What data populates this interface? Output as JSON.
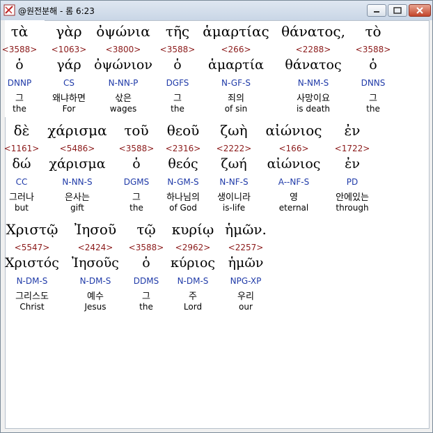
{
  "window": {
    "title": "@원전분해 - 롬 6:23"
  },
  "rows": [
    {
      "words": [
        {
          "greek": "τὰ",
          "strong": "<3588>",
          "lemma": "ὁ",
          "parse": "DNNP",
          "kor": "그",
          "eng": "the"
        },
        {
          "greek": "γὰρ",
          "strong": "<1063>",
          "lemma": "γάρ",
          "parse": "CS",
          "kor": "왜냐하면",
          "eng": "For"
        },
        {
          "greek": "ὀψώνια",
          "strong": "<3800>",
          "lemma": "ὀψώνιον",
          "parse": "N-NN-P",
          "kor": "삯은",
          "eng": "wages"
        },
        {
          "greek": "τῆς",
          "strong": "<3588>",
          "lemma": "ὁ",
          "parse": "DGFS",
          "kor": "그",
          "eng": "the"
        },
        {
          "greek": "ἁμαρτίας",
          "strong": "<266>",
          "lemma": "ἁμαρτία",
          "parse": "N-GF-S",
          "kor": "죄의",
          "eng": "of sin"
        },
        {
          "greek": "θάνατος,",
          "strong": "<2288>",
          "lemma": "θάνατος",
          "parse": "N-NM-S",
          "kor": "사망이요",
          "eng": "is death"
        },
        {
          "greek": "τὸ",
          "strong": "<3588>",
          "lemma": "ὁ",
          "parse": "DNNS",
          "kor": "그",
          "eng": "the"
        }
      ]
    },
    {
      "words": [
        {
          "greek": "δὲ",
          "strong": "<1161>",
          "lemma": "δώ",
          "parse": "CC",
          "kor": "그러나",
          "eng": "but"
        },
        {
          "greek": "χάρισμα",
          "strong": "<5486>",
          "lemma": "χάρισμα",
          "parse": "N-NN-S",
          "kor": "은사는",
          "eng": "gift"
        },
        {
          "greek": "τοῦ",
          "strong": "<3588>",
          "lemma": "ὁ",
          "parse": "DGMS",
          "kor": "그",
          "eng": "the"
        },
        {
          "greek": "θεοῦ",
          "strong": "<2316>",
          "lemma": "θεός",
          "parse": "N-GM-S",
          "kor": "하나님의",
          "eng": "of God"
        },
        {
          "greek": "ζωὴ",
          "strong": "<2222>",
          "lemma": "ζωή",
          "parse": "N-NF-S",
          "kor": "생이니라",
          "eng": "is-life"
        },
        {
          "greek": "αἰώνιος",
          "strong": "<166>",
          "lemma": "αἰώνιος",
          "parse": "A--NF-S",
          "kor": "영",
          "eng": "eternal"
        },
        {
          "greek": "ἐν",
          "strong": "<1722>",
          "lemma": "ἐν",
          "parse": "PD",
          "kor": "안에있는",
          "eng": "through"
        }
      ]
    },
    {
      "words": [
        {
          "greek": "Χριστῷ",
          "strong": "<5547>",
          "lemma": "Χριστός",
          "parse": "N-DM-S",
          "kor": "그리스도",
          "eng": "Christ"
        },
        {
          "greek": "Ἰησοῦ",
          "strong": "<2424>",
          "lemma": "Ἰησοῦς",
          "parse": "N-DM-S",
          "kor": "예수",
          "eng": "Jesus"
        },
        {
          "greek": "τῷ",
          "strong": "<3588>",
          "lemma": "ὁ",
          "parse": "DDMS",
          "kor": "그",
          "eng": "the"
        },
        {
          "greek": "κυρίῳ",
          "strong": "<2962>",
          "lemma": "κύριος",
          "parse": "N-DM-S",
          "kor": "주",
          "eng": "Lord"
        },
        {
          "greek": "ἡμῶν.",
          "strong": "<2257>",
          "lemma": "ἡμῶν",
          "parse": "NPG-XP",
          "kor": "우리",
          "eng": "our"
        }
      ]
    }
  ]
}
